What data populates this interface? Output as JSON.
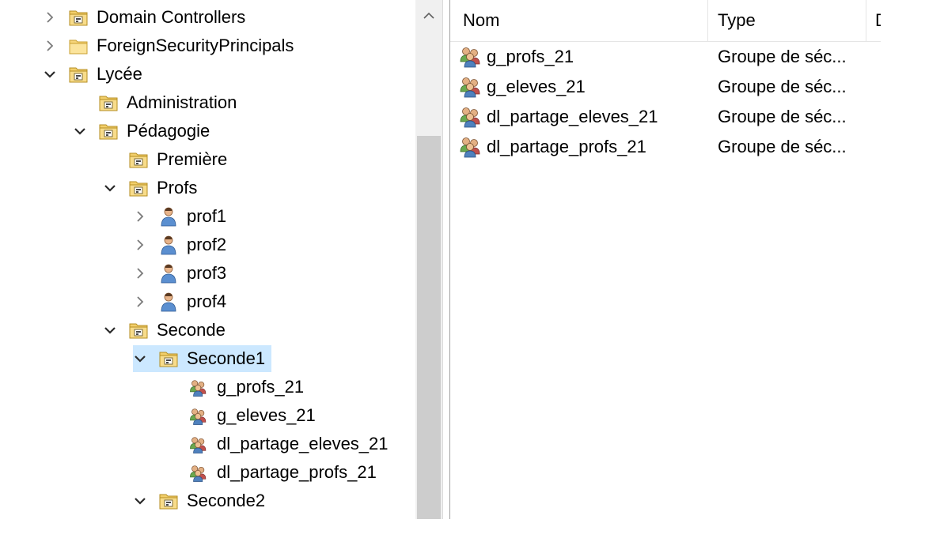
{
  "tree": {
    "items": [
      {
        "label": "Domain Controllers",
        "expander": "collapsed",
        "icon": "ou-folder-icon",
        "depth": 0
      },
      {
        "label": "ForeignSecurityPrincipals",
        "expander": "collapsed",
        "icon": "folder-icon",
        "depth": 0
      },
      {
        "label": "Lycée",
        "expander": "expanded",
        "icon": "ou-folder-icon",
        "depth": 0
      },
      {
        "label": "Administration",
        "expander": "none",
        "icon": "ou-folder-icon",
        "depth": 1
      },
      {
        "label": "Pédagogie",
        "expander": "expanded",
        "icon": "ou-folder-icon",
        "depth": 1
      },
      {
        "label": "Première",
        "expander": "none",
        "icon": "ou-folder-icon",
        "depth": 2
      },
      {
        "label": "Profs",
        "expander": "expanded",
        "icon": "ou-folder-icon",
        "depth": 2
      },
      {
        "label": "prof1",
        "expander": "collapsed",
        "icon": "user-icon",
        "depth": 3
      },
      {
        "label": "prof2",
        "expander": "collapsed",
        "icon": "user-icon",
        "depth": 3
      },
      {
        "label": "prof3",
        "expander": "collapsed",
        "icon": "user-icon",
        "depth": 3
      },
      {
        "label": "prof4",
        "expander": "collapsed",
        "icon": "user-icon",
        "depth": 3
      },
      {
        "label": "Seconde",
        "expander": "expanded",
        "icon": "ou-folder-icon",
        "depth": 2
      },
      {
        "label": "Seconde1",
        "expander": "expanded",
        "icon": "ou-folder-icon",
        "depth": 3,
        "selected": true
      },
      {
        "label": "g_profs_21",
        "expander": "none",
        "icon": "group-icon",
        "depth": 4
      },
      {
        "label": "g_eleves_21",
        "expander": "none",
        "icon": "group-icon",
        "depth": 4
      },
      {
        "label": "dl_partage_eleves_21",
        "expander": "none",
        "icon": "group-icon",
        "depth": 4
      },
      {
        "label": "dl_partage_profs_21",
        "expander": "none",
        "icon": "group-icon",
        "depth": 4
      },
      {
        "label": "Seconde2",
        "expander": "expanded",
        "icon": "ou-folder-icon",
        "depth": 3
      }
    ]
  },
  "list": {
    "columns": [
      "Nom",
      "Type",
      "D"
    ],
    "rows": [
      {
        "name": "g_profs_21",
        "type": "Groupe de séc..."
      },
      {
        "name": "g_eleves_21",
        "type": "Groupe de séc..."
      },
      {
        "name": "dl_partage_eleves_21",
        "type": "Groupe de séc..."
      },
      {
        "name": "dl_partage_profs_21",
        "type": "Groupe de séc..."
      }
    ]
  },
  "colors": {
    "selection": "#cce8ff",
    "folder_yellow": "#f2cf6b",
    "scroll_thumb": "#cdcdcd",
    "scroll_track": "#f0f0f0"
  }
}
